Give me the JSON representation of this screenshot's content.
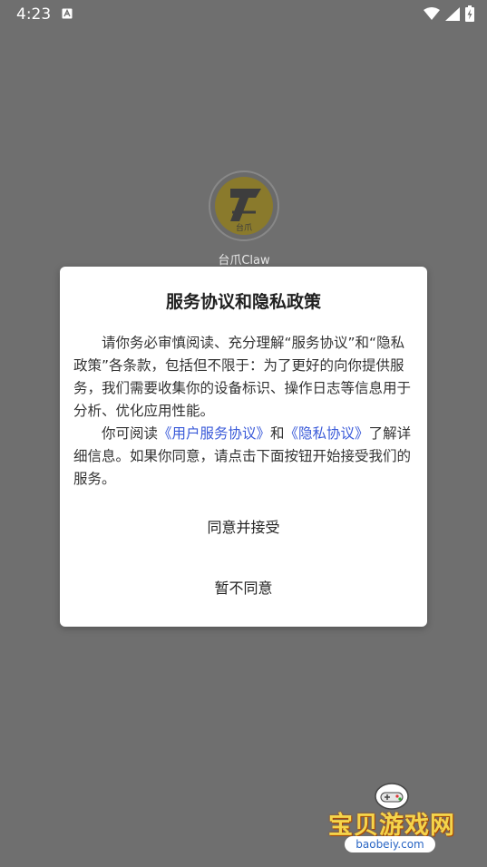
{
  "status_bar": {
    "time": "4:23"
  },
  "app": {
    "name": "台爪Claw",
    "logo_text": "台爪"
  },
  "dialog": {
    "title": "服务协议和隐私政策",
    "para1": "请你务必审慎阅读、充分理解“服务协议”和“隐私政策”各条款，包括但不限于：为了更好的向你提供服务，我们需要收集你的设备标识、操作日志等信息用于分析、优化应用性能。",
    "para2_prefix": "你可阅读",
    "link_user": "《用户服务协议》",
    "para2_and": "和",
    "link_privacy": "《隐私协议》",
    "para2_suffix": "了解详细信息。如果你同意，请点击下面按钮开始接受我们的服务。",
    "accept_label": "同意并接受",
    "decline_label": "暂不同意"
  },
  "watermark": {
    "text": "宝贝游戏网",
    "url": "baobeiy.com"
  },
  "colors": {
    "link": "#3b5bd9",
    "overlay": "#6f6f6f"
  }
}
